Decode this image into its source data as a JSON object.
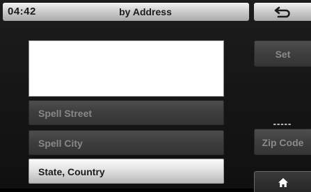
{
  "header": {
    "time": "04:42",
    "title": "by Address",
    "back_icon": "return-arrow-icon"
  },
  "address_input": {
    "value": "",
    "placeholder": ""
  },
  "list": {
    "items": [
      {
        "label": "Spell Street",
        "state": "disabled"
      },
      {
        "label": "Spell City",
        "state": "disabled"
      },
      {
        "label": "State, Country",
        "state": "active"
      }
    ]
  },
  "side": {
    "set_label": "Set",
    "zip_value": "-----",
    "zip_label": "Zip Code",
    "home_icon": "home-icon"
  },
  "colors": {
    "header": "#cfcfcf",
    "disabled_button": "#3d3d3d",
    "active_button": "#e2e2e2",
    "background": "#171717"
  }
}
